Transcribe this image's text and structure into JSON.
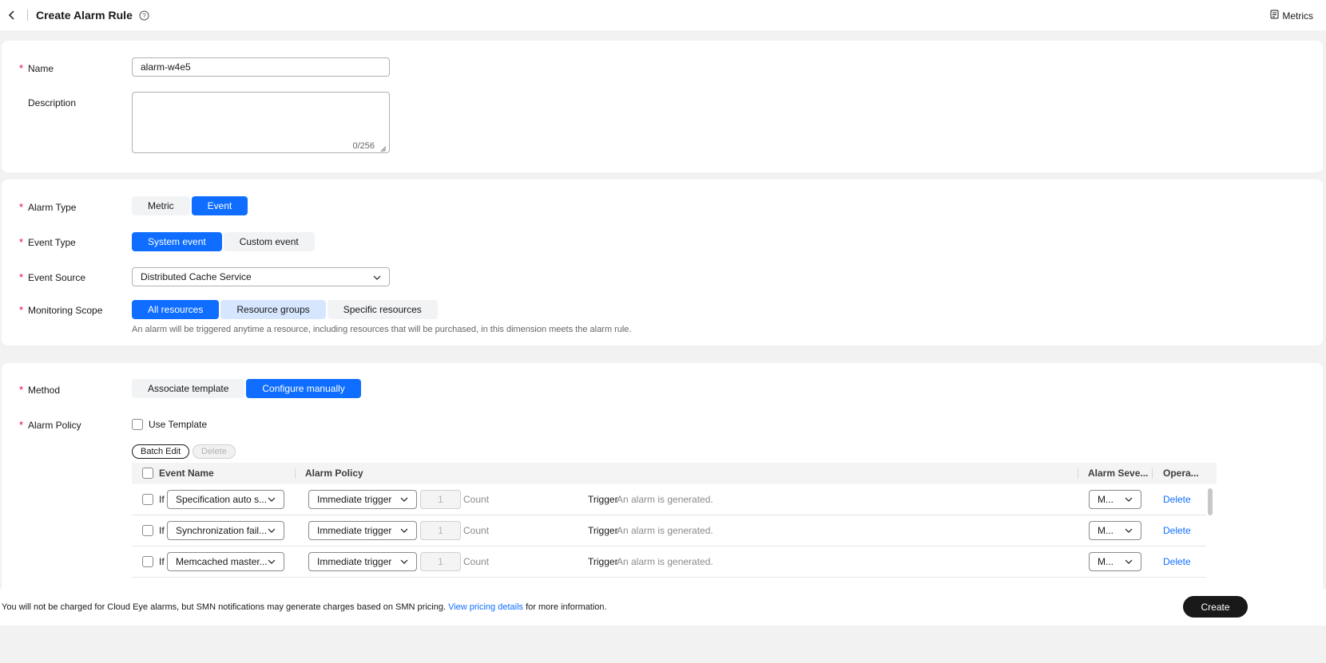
{
  "header": {
    "title": "Create Alarm Rule",
    "metrics_link": "Metrics"
  },
  "basic": {
    "name_label": "Name",
    "name_value": "alarm-w4e5",
    "description_label": "Description",
    "description_counter": "0/256"
  },
  "alarm": {
    "alarm_type_label": "Alarm Type",
    "alarm_type_options": [
      "Metric",
      "Event"
    ],
    "alarm_type_selected": "Event",
    "event_type_label": "Event Type",
    "event_type_options": [
      "System event",
      "Custom event"
    ],
    "event_type_selected": "System event",
    "event_source_label": "Event Source",
    "event_source_value": "Distributed Cache Service",
    "scope_label": "Monitoring Scope",
    "scope_options": [
      "All resources",
      "Resource groups",
      "Specific resources"
    ],
    "scope_selected": "All resources",
    "scope_hint": "An alarm will be triggered anytime a resource, including resources that will be purchased, in this dimension meets the alarm rule."
  },
  "policy": {
    "method_label": "Method",
    "method_options": [
      "Associate template",
      "Configure manually"
    ],
    "method_selected": "Configure manually",
    "alarm_policy_label": "Alarm Policy",
    "use_template_label": "Use Template",
    "batch_edit_label": "Batch Edit",
    "delete_label": "Delete",
    "table": {
      "headers": {
        "event_name": "Event Name",
        "alarm_policy": "Alarm Policy",
        "alarm_severity": "Alarm Seve...",
        "operation": "Opera..."
      },
      "rows": [
        {
          "if": "If",
          "event": "Specification auto s...",
          "trigger": "Immediate trigger",
          "count": "1",
          "count_unit": "Count",
          "trigger_label": "Trigger",
          "trigger_desc": "An alarm is generated.",
          "severity": "M...",
          "action": "Delete"
        },
        {
          "if": "If",
          "event": "Synchronization fail...",
          "trigger": "Immediate trigger",
          "count": "1",
          "count_unit": "Count",
          "trigger_label": "Trigger",
          "trigger_desc": "An alarm is generated.",
          "severity": "M...",
          "action": "Delete"
        },
        {
          "if": "If",
          "event": "Memcached master...",
          "trigger": "Immediate trigger",
          "count": "1",
          "count_unit": "Count",
          "trigger_label": "Trigger",
          "trigger_desc": "An alarm is generated.",
          "severity": "M...",
          "action": "Delete"
        }
      ]
    }
  },
  "footer": {
    "text_before": "You will not be charged for Cloud Eye alarms, but SMN notifications may generate charges based on SMN pricing.",
    "pricing_link": "View pricing details",
    "text_after": "for more information.",
    "create_label": "Create"
  }
}
